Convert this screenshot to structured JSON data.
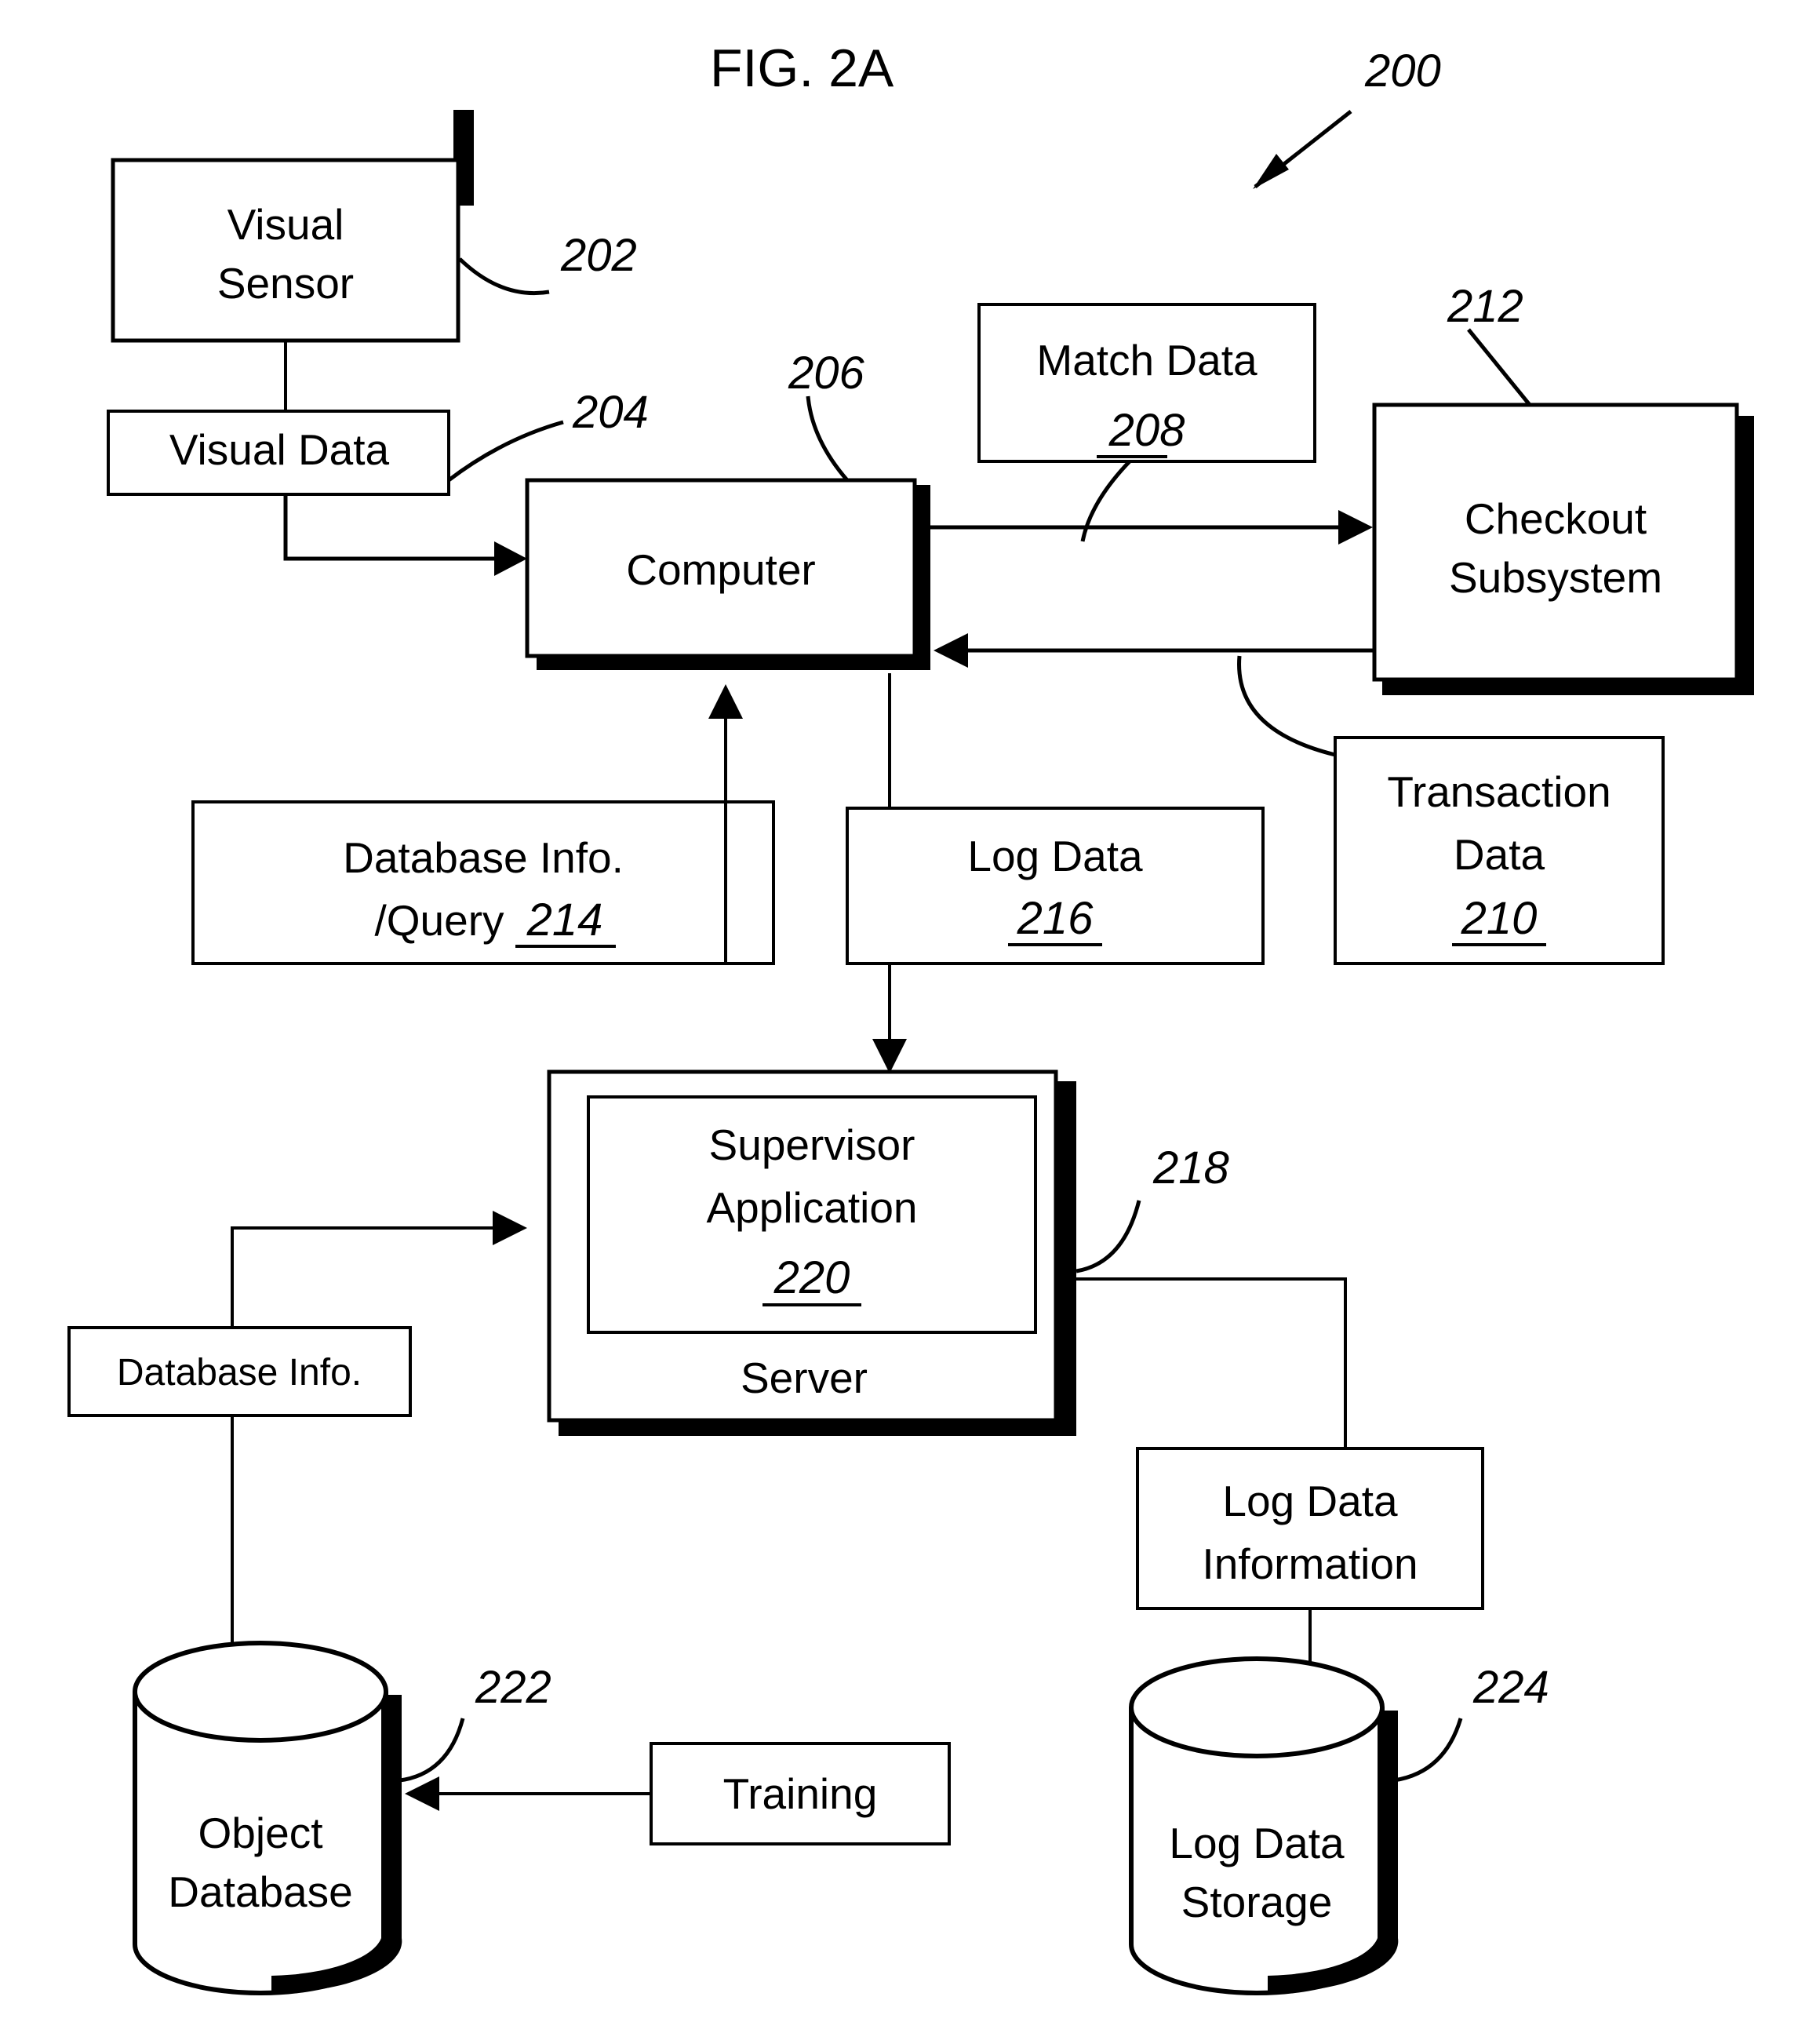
{
  "figure": {
    "title": "FIG. 2A",
    "system_ref": "200"
  },
  "nodes": {
    "visual_sensor": {
      "label_line1": "Visual",
      "label_line2": "Sensor",
      "ref": "202"
    },
    "visual_data": {
      "label": "Visual Data",
      "ref": "204"
    },
    "computer": {
      "label": "Computer",
      "ref": "206"
    },
    "match_data": {
      "label": "Match Data",
      "ref": "208"
    },
    "checkout_subsystem": {
      "label_line1": "Checkout",
      "label_line2": "Subsystem",
      "ref": "212"
    },
    "transaction_data": {
      "label_line1": "Transaction",
      "label_line2": "Data",
      "ref": "210"
    },
    "database_info_query": {
      "label_line1": "Database Info.",
      "label_line2": "/Query",
      "ref": "214"
    },
    "log_data": {
      "label": "Log Data",
      "ref": "216"
    },
    "server": {
      "label": "Server",
      "ref": "218"
    },
    "supervisor_application": {
      "label_line1": "Supervisor",
      "label_line2": "Application",
      "ref": "220"
    },
    "database_info": {
      "label": "Database Info."
    },
    "object_database": {
      "label_line1": "Object",
      "label_line2": "Database",
      "ref": "222"
    },
    "training": {
      "label": "Training"
    },
    "log_data_information": {
      "label_line1": "Log Data",
      "label_line2": "Information"
    },
    "log_data_storage": {
      "label_line1": "Log Data",
      "label_line2": "Storage",
      "ref": "224"
    }
  }
}
